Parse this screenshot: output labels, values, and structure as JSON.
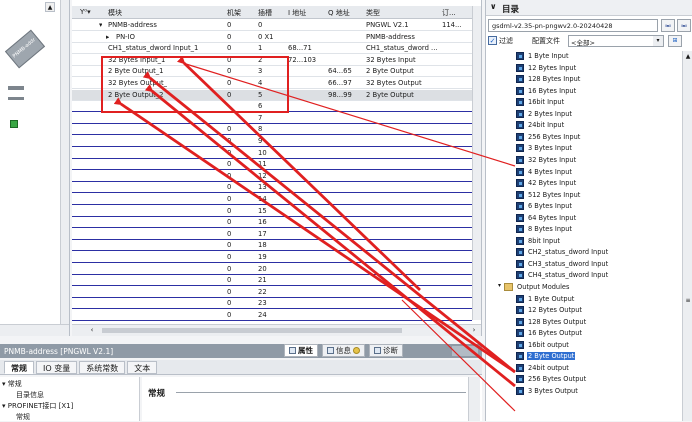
{
  "table": {
    "headers": {
      "module": "模块",
      "rack": "机架",
      "slot": "插槽",
      "i_address": "I 地址",
      "q_address": "Q 地址",
      "type": "类型",
      "order": "订..."
    },
    "rows": [
      {
        "module": "PNMB-address",
        "rack": "0",
        "slot": "0",
        "i": "",
        "q": "",
        "type": "PNGWL V2.1",
        "order": "114..."
      },
      {
        "module": "PN-IO",
        "rack": "0",
        "slot": "0 X1",
        "i": "",
        "q": "",
        "type": "PNMB-address",
        "order": ""
      },
      {
        "module": "CH1_status_dword Input_1",
        "rack": "0",
        "slot": "1",
        "i": "68...71",
        "q": "",
        "type": "CH1_status_dword ...",
        "order": ""
      },
      {
        "module": "32 Bytes Input_1",
        "rack": "0",
        "slot": "2",
        "i": "72...103",
        "q": "",
        "type": "32 Bytes Input",
        "order": ""
      },
      {
        "module": "2 Byte Output_1",
        "rack": "0",
        "slot": "3",
        "i": "",
        "q": "64...65",
        "type": "2 Byte Output",
        "order": ""
      },
      {
        "module": "32 Bytes Output_",
        "rack": "0",
        "slot": "4",
        "i": "",
        "q": "66...97",
        "type": "32 Bytes Output",
        "order": ""
      },
      {
        "module": "2 Byte Output_2",
        "rack": "0",
        "slot": "5",
        "i": "",
        "q": "98...99",
        "type": "2 Byte Output",
        "order": ""
      },
      {
        "module": "",
        "rack": "",
        "slot": "6",
        "i": "",
        "q": "",
        "type": "",
        "order": ""
      },
      {
        "module": "",
        "rack": "",
        "slot": "7",
        "i": "",
        "q": "",
        "type": "",
        "order": ""
      },
      {
        "module": "",
        "rack": "0",
        "slot": "8",
        "i": "",
        "q": "",
        "type": "",
        "order": ""
      },
      {
        "module": "",
        "rack": "0",
        "slot": "9",
        "i": "",
        "q": "",
        "type": "",
        "order": ""
      },
      {
        "module": "",
        "rack": "0",
        "slot": "10",
        "i": "",
        "q": "",
        "type": "",
        "order": ""
      },
      {
        "module": "",
        "rack": "0",
        "slot": "11",
        "i": "",
        "q": "",
        "type": "",
        "order": ""
      },
      {
        "module": "",
        "rack": "0",
        "slot": "12",
        "i": "",
        "q": "",
        "type": "",
        "order": ""
      },
      {
        "module": "",
        "rack": "0",
        "slot": "13",
        "i": "",
        "q": "",
        "type": "",
        "order": ""
      },
      {
        "module": "",
        "rack": "0",
        "slot": "14",
        "i": "",
        "q": "",
        "type": "",
        "order": ""
      },
      {
        "module": "",
        "rack": "0",
        "slot": "15",
        "i": "",
        "q": "",
        "type": "",
        "order": ""
      },
      {
        "module": "",
        "rack": "0",
        "slot": "16",
        "i": "",
        "q": "",
        "type": "",
        "order": ""
      },
      {
        "module": "",
        "rack": "0",
        "slot": "17",
        "i": "",
        "q": "",
        "type": "",
        "order": ""
      },
      {
        "module": "",
        "rack": "0",
        "slot": "18",
        "i": "",
        "q": "",
        "type": "",
        "order": ""
      },
      {
        "module": "",
        "rack": "0",
        "slot": "19",
        "i": "",
        "q": "",
        "type": "",
        "order": ""
      },
      {
        "module": "",
        "rack": "0",
        "slot": "20",
        "i": "",
        "q": "",
        "type": "",
        "order": ""
      },
      {
        "module": "",
        "rack": "0",
        "slot": "21",
        "i": "",
        "q": "",
        "type": "",
        "order": ""
      },
      {
        "module": "",
        "rack": "0",
        "slot": "22",
        "i": "",
        "q": "",
        "type": "",
        "order": ""
      },
      {
        "module": "",
        "rack": "0",
        "slot": "23",
        "i": "",
        "q": "",
        "type": "",
        "order": ""
      },
      {
        "module": "",
        "rack": "0",
        "slot": "24",
        "i": "",
        "q": "",
        "type": "",
        "order": ""
      }
    ]
  },
  "catalog": {
    "title": "目录",
    "search_value": "gsdml-v2.35-pn-pngwv2.0-20240428",
    "filter_label": "过滤",
    "profile_label": "配置文件",
    "profile_value": "<全部>",
    "search_btn1": "ᵢₙᵢ",
    "search_btn2": "ᵢₙᵢ",
    "items": [
      "1 Byte Input",
      "12 Bytes Input",
      "128 Bytes Input",
      "16 Bytes Input",
      "16bit Input",
      "2 Bytes Input",
      "24bit Input",
      "256 Bytes Input",
      "3 Bytes Input",
      "32 Bytes Input",
      "4 Bytes Input",
      "42 Bytes Input",
      "512 Bytes Input",
      "6 Bytes Input",
      "64 Bytes Input",
      "8 Bytes Input",
      "8bit Input",
      "CH2_status_dword Input",
      "CH3_status_dword Input",
      "CH4_status_dword Input"
    ],
    "output_folder": "Output Modules",
    "output_items": [
      "1 Byte Output",
      "12 Bytes Output",
      "128 Bytes Output",
      "16 Bytes Output",
      "16bit output",
      "2 Byte Output",
      "24bit output",
      "256 Bytes Output",
      "3 Bytes Output"
    ],
    "selected_output": "2 Byte Output"
  },
  "left": {
    "device_label": "PNMB-addr"
  },
  "properties": {
    "title": "PNMB-address [PNGWL V2.1]",
    "tab_properties": "属性",
    "tab_info": "信息",
    "tab_diagnostics": "诊断",
    "subtabs": [
      "常规",
      "IO 变量",
      "系统常数",
      "文本"
    ],
    "tree": {
      "general": "常规",
      "catalog_info": "目录信息",
      "profinet": "PROFINET接口 [X1]",
      "more": "常规"
    },
    "heading": "常规"
  },
  "colors": {
    "annotation_red": "#e02020",
    "row_separator_blue": "#2c2fa3",
    "selection_blue": "#2f6fd1"
  }
}
